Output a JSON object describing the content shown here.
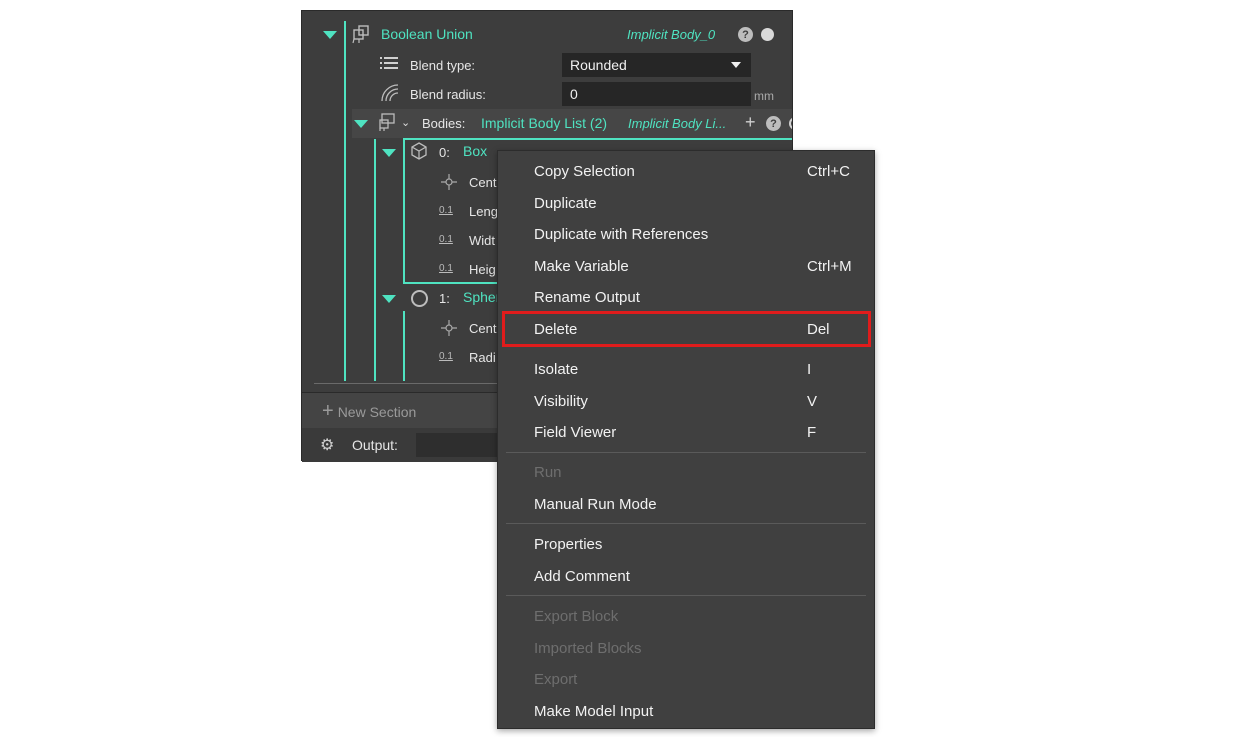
{
  "tree": {
    "boolean_union": {
      "label": "Boolean Union",
      "output": "Implicit Body_0"
    },
    "blend_type": {
      "label": "Blend type:",
      "value": "Rounded"
    },
    "blend_radius": {
      "label": "Blend radius:",
      "value": "0",
      "unit": "mm"
    },
    "bodies": {
      "label": "Bodies:",
      "list": "Implicit Body List (2)",
      "output": "Implicit Body Li..."
    },
    "box": {
      "index": "0:",
      "label": "Box"
    },
    "box_fields": [
      "Cent",
      "Leng",
      "Widt",
      "Heig"
    ],
    "sphere": {
      "index": "1:",
      "label": "Spher"
    },
    "sphere_fields": [
      "Cent",
      "Radi"
    ],
    "number_badge": "0.1"
  },
  "bottom": {
    "new_section": "New Section",
    "output_label": "Output:"
  },
  "menu": {
    "items": [
      {
        "label": "Copy Selection",
        "shortcut": "Ctrl+C"
      },
      {
        "label": "Duplicate",
        "shortcut": ""
      },
      {
        "label": "Duplicate with References",
        "shortcut": ""
      },
      {
        "label": "Make Variable",
        "shortcut": "Ctrl+M"
      },
      {
        "label": "Rename Output",
        "shortcut": ""
      },
      {
        "label": "Delete",
        "shortcut": "Del"
      },
      {
        "label": "Isolate",
        "shortcut": "I"
      },
      {
        "label": "Visibility",
        "shortcut": "V"
      },
      {
        "label": "Field Viewer",
        "shortcut": "F"
      },
      {
        "label": "Run",
        "shortcut": ""
      },
      {
        "label": "Manual Run Mode",
        "shortcut": ""
      },
      {
        "label": "Properties",
        "shortcut": ""
      },
      {
        "label": "Add Comment",
        "shortcut": ""
      },
      {
        "label": "Export Block",
        "shortcut": ""
      },
      {
        "label": "Imported Blocks",
        "shortcut": ""
      },
      {
        "label": "Export",
        "shortcut": ""
      },
      {
        "label": "Make Model Input",
        "shortcut": ""
      }
    ]
  },
  "colors": {
    "accent": "#4fe3c1",
    "highlight": "#e01c1c",
    "panel": "#3d3d3d",
    "menu": "#404040"
  }
}
